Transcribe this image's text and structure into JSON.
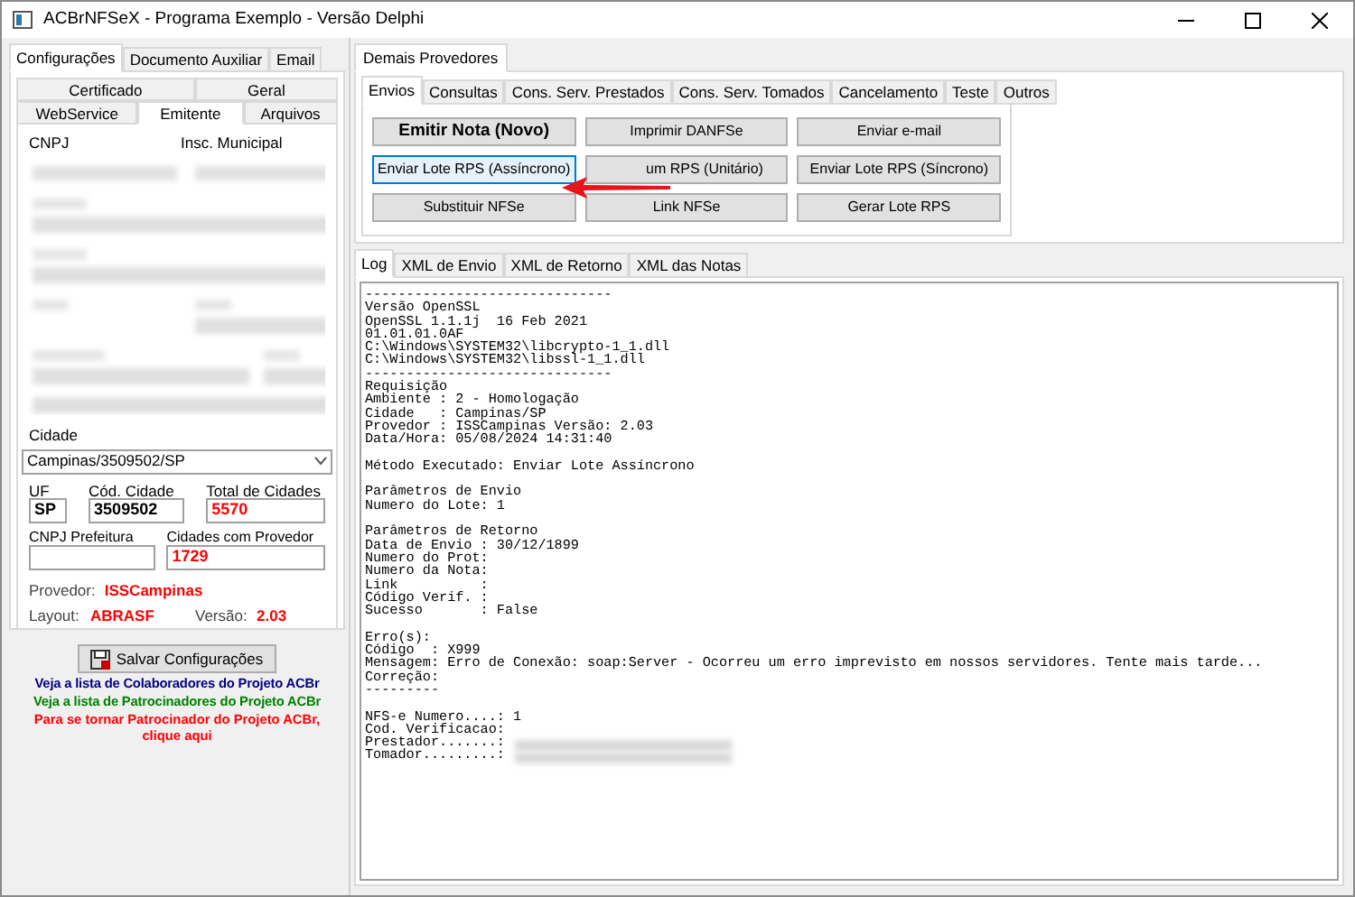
{
  "window": {
    "title": "ACBrNFSeX - Programa Exemplo - Versão Delphi"
  },
  "left_tabs": [
    {
      "label": "Configurações",
      "selected": true
    },
    {
      "label": "Documento Auxiliar",
      "selected": false
    },
    {
      "label": "Email",
      "selected": false
    }
  ],
  "config_tabs_row1": [
    {
      "label": "Certificado",
      "selected": false
    },
    {
      "label": "Geral",
      "selected": false
    }
  ],
  "config_tabs_row2": [
    {
      "label": "WebService",
      "selected": false
    },
    {
      "label": "Emitente",
      "selected": true
    },
    {
      "label": "Arquivos",
      "selected": false
    }
  ],
  "emitente": {
    "cnpj_label": "CNPJ",
    "insc_label": "Insc. Municipal",
    "cidade_label": "Cidade",
    "cidade_value": "Campinas/3509502/SP",
    "uf_label": "UF",
    "uf_value": "SP",
    "cod_label": "Cód. Cidade",
    "cod_value": "3509502",
    "total_label": "Total de Cidades",
    "total_value": "5570",
    "cnpj_pref_label": "CNPJ Prefeitura",
    "com_prov_label": "Cidades com Provedor",
    "com_prov_value": "1729",
    "provedor_label": "Provedor:",
    "provedor_value": "ISSCampinas",
    "layout_label": "Layout:",
    "layout_value": "ABRASF",
    "versao_label": "Versão:",
    "versao_value": "2.03"
  },
  "save_button": "Salvar Configurações",
  "links": [
    {
      "text": "Veja a lista de Colaboradores do Projeto ACBr",
      "color": "#000080"
    },
    {
      "text": "Veja a lista de Patrocinadores do Projeto ACBr",
      "color": "#008000"
    },
    {
      "text": "Para se tornar Patrocinador do Projeto ACBr, clique aqui",
      "color": "#ff0000"
    }
  ],
  "right_tabs": [
    {
      "label": "Demais Provedores",
      "selected": true
    }
  ],
  "action_tabs": [
    {
      "label": "Envios",
      "selected": true
    },
    {
      "label": "Consultas",
      "selected": false
    },
    {
      "label": "Cons. Serv. Prestados",
      "selected": false
    },
    {
      "label": "Cons. Serv. Tomados",
      "selected": false
    },
    {
      "label": "Cancelamento",
      "selected": false
    },
    {
      "label": "Teste",
      "selected": false
    },
    {
      "label": "Outros",
      "selected": false
    }
  ],
  "buttons": [
    {
      "label": "Emitir Nota (Novo)",
      "bold": true,
      "focused": false
    },
    {
      "label": "Imprimir DANFSe",
      "bold": false,
      "focused": false
    },
    {
      "label": "Enviar e-mail",
      "bold": false,
      "focused": false
    },
    {
      "label": "Enviar Lote RPS (Assíncrono)",
      "bold": false,
      "focused": true
    },
    {
      "label": "um RPS (Unitário)",
      "bold": false,
      "focused": false
    },
    {
      "label": "Enviar Lote RPS (Síncrono)",
      "bold": false,
      "focused": false
    },
    {
      "label": "Substituir NFSe",
      "bold": false,
      "focused": false
    },
    {
      "label": "Link NFSe",
      "bold": false,
      "focused": false
    },
    {
      "label": "Gerar Lote RPS",
      "bold": false,
      "focused": false
    }
  ],
  "log_tabs": [
    {
      "label": "Log",
      "selected": true
    },
    {
      "label": "XML de Envio",
      "selected": false
    },
    {
      "label": "XML de Retorno",
      "selected": false
    },
    {
      "label": "XML das Notas",
      "selected": false
    }
  ],
  "log": [
    [
      "------------------------------",
      "Versão OpenSSL",
      "OpenSSL 1.1.1j  16 Feb 2021",
      "01.01.01.0AF",
      "C:\\Windows\\SYSTEM32\\libcrypto-1_1.dll",
      "C:\\Windows\\SYSTEM32\\libssl-1_1.dll",
      "------------------------------",
      "Requisição",
      "Ambiente : 2 - Homologação",
      "Cidade   : Campinas/SP",
      "Provedor : ISSCampinas Versão: 2.03",
      "Data/Hora: 05/08/2024 14:31:40"
    ],
    [
      "Método Executado: Enviar Lote Assíncrono"
    ],
    [
      "Parâmetros de Envio",
      "Numero do Lote: 1"
    ],
    [
      "Parâmetros de Retorno",
      "Data de Envio : 30/12/1899",
      "Numero do Prot:",
      "Numero da Nota:",
      "Link          :",
      "Código Verif. :",
      "Sucesso       : False"
    ],
    [
      "Erro(s):",
      "Código  : X999",
      "Mensagem: Erro de Conexão: soap:Server - Ocorreu um erro imprevisto em nossos servidores. Tente mais tarde...",
      "Correção:",
      "---------"
    ],
    [
      "NFS-e Numero....: 1",
      "Cod. Verificacao:",
      "Prestador.......:",
      "Tomador.........:"
    ]
  ]
}
